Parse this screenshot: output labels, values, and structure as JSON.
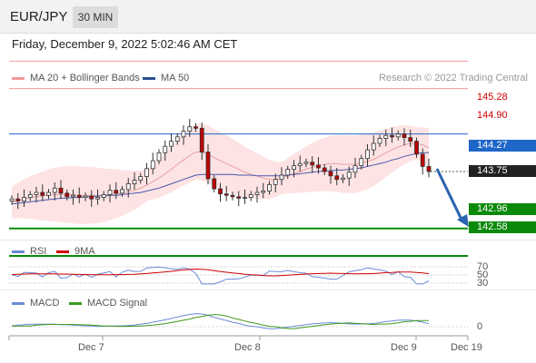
{
  "header": {
    "pair": "EUR/JPY",
    "timeframe": "30 MIN"
  },
  "datetime": "Friday, December 9, 2022 5:02:46 AM CET",
  "legend": {
    "ma20": "MA 20 + Bollinger Bands",
    "ma50": "MA 50",
    "copyright": "Research © 2022 Trading Central",
    "rsi": "RSI",
    "rsi9": "9MA",
    "macd": "MACD",
    "macd_signal": "MACD Signal"
  },
  "colors": {
    "resistance": "#f29a9a",
    "resistance_text": "#d00000",
    "pivot": "#1f66c9",
    "current": "#222222",
    "support": "#0a8a0a",
    "arrow": "#2a63b0",
    "candle_up": "#3a3a3a",
    "candle_down": "#c00000",
    "ma20": "#e8a0a0",
    "ma50": "#4a58b0",
    "band_fill": "#fde3e3"
  },
  "levels": {
    "r2": "145.28",
    "r1": "144.90",
    "pivot": "144.27",
    "last": "143.75",
    "s1": "142.96",
    "s2": "142.58"
  },
  "rsi_levels": [
    "70",
    "50",
    "30"
  ],
  "macd_zero": "0",
  "x_axis": [
    "Dec 7",
    "Dec 8",
    "Dec 9",
    "Dec 19"
  ],
  "chart_data": {
    "type": "line",
    "xlabel": "",
    "ylabel": "",
    "x_ticks": [
      "Dec 7",
      "Dec 8",
      "Dec 9",
      "Dec 19"
    ],
    "y_levels": [
      145.28,
      144.9,
      144.27,
      143.75,
      142.96,
      142.58
    ],
    "close": [
      143.37,
      143.34,
      143.39,
      143.43,
      143.46,
      143.42,
      143.46,
      143.52,
      143.45,
      143.4,
      143.42,
      143.39,
      143.41,
      143.37,
      143.39,
      143.43,
      143.49,
      143.45,
      143.5,
      143.58,
      143.63,
      143.68,
      143.79,
      143.9,
      144.01,
      144.1,
      144.17,
      144.23,
      144.31,
      144.37,
      144.35,
      144.02,
      143.65,
      143.51,
      143.44,
      143.42,
      143.4,
      143.38,
      143.39,
      143.43,
      143.46,
      143.48,
      143.57,
      143.64,
      143.7,
      143.78,
      143.83,
      143.86,
      143.88,
      143.84,
      143.8,
      143.75,
      143.69,
      143.64,
      143.66,
      143.74,
      143.83,
      143.93,
      144.05,
      144.14,
      144.21,
      144.25,
      144.23,
      144.27,
      144.22,
      144.17,
      143.99,
      143.82,
      143.75
    ],
    "ma20": [
      143.32,
      143.35,
      143.37,
      143.39,
      143.4,
      143.41,
      143.42,
      143.43,
      143.43,
      143.43,
      143.43,
      143.42,
      143.42,
      143.42,
      143.42,
      143.42,
      143.43,
      143.44,
      143.45,
      143.47,
      143.49,
      143.52,
      143.56,
      143.61,
      143.66,
      143.72,
      143.78,
      143.85,
      143.91,
      143.97,
      144.02,
      144.02,
      143.99,
      143.94,
      143.9,
      143.86,
      143.82,
      143.78,
      143.74,
      143.71,
      143.69,
      143.66,
      143.64,
      143.64,
      143.66,
      143.69,
      143.72,
      143.75,
      143.78,
      143.81,
      143.83,
      143.85,
      143.86,
      143.86,
      143.85,
      143.85,
      143.85,
      143.87,
      143.89,
      143.92,
      143.96,
      144.01,
      144.05,
      144.09,
      144.12,
      144.14,
      144.14,
      144.12,
      144.08
    ],
    "ma50": [
      143.3,
      143.31,
      143.32,
      143.33,
      143.34,
      143.35,
      143.36,
      143.37,
      143.38,
      143.38,
      143.39,
      143.39,
      143.4,
      143.4,
      143.41,
      143.41,
      143.42,
      143.42,
      143.43,
      143.44,
      143.45,
      143.46,
      143.48,
      143.5,
      143.52,
      143.55,
      143.58,
      143.61,
      143.64,
      143.67,
      143.7,
      143.71,
      143.71,
      143.71,
      143.71,
      143.71,
      143.71,
      143.7,
      143.7,
      143.7,
      143.69,
      143.69,
      143.69,
      143.69,
      143.69,
      143.7,
      143.71,
      143.72,
      143.73,
      143.74,
      143.75,
      143.76,
      143.76,
      143.77,
      143.77,
      143.78,
      143.79,
      143.8,
      143.82,
      143.84,
      143.86,
      143.88,
      143.91,
      143.93,
      143.96,
      143.98,
      144.0,
      144.01,
      144.01
    ]
  }
}
